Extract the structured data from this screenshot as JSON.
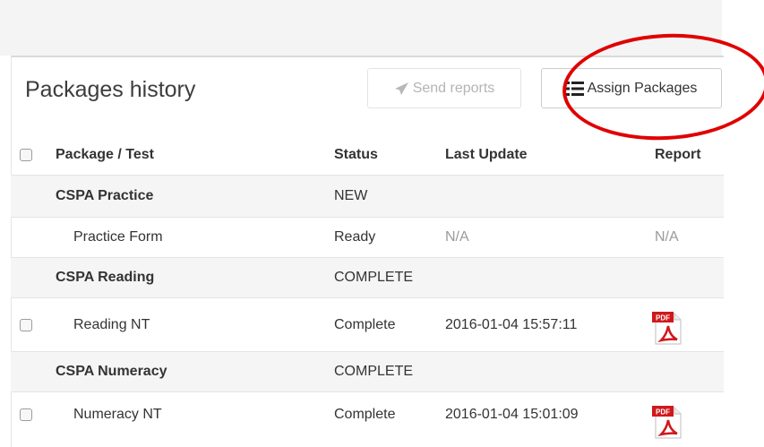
{
  "panel": {
    "title": "Packages history",
    "send_reports_label": "Send reports",
    "assign_packages_label": "Assign Packages"
  },
  "table": {
    "columns": [
      "Package / Test",
      "Status",
      "Last Update",
      "Report"
    ],
    "rows": [
      {
        "type": "group",
        "name": "CSPA Practice",
        "status": "NEW"
      },
      {
        "type": "item",
        "name": "Practice Form",
        "status": "Ready",
        "last_update": "N/A",
        "report": "N/A",
        "checkbox": false
      },
      {
        "type": "group",
        "name": "CSPA Reading",
        "status": "COMPLETE"
      },
      {
        "type": "item",
        "name": "Reading NT",
        "status": "Complete",
        "last_update": "2016-01-04 15:57:11",
        "report_icon": "pdf-icon",
        "checkbox": true
      },
      {
        "type": "group",
        "name": "CSPA Numeracy",
        "status": "COMPLETE"
      },
      {
        "type": "item",
        "name": "Numeracy NT",
        "status": "Complete",
        "last_update": "2016-01-04 15:01:09",
        "report_icon": "pdf-icon",
        "checkbox": true
      }
    ]
  },
  "pdf_badge_text": "PDF",
  "colors": {
    "highlight_circle": "#e00000",
    "pdf_red": "#d0181c"
  }
}
